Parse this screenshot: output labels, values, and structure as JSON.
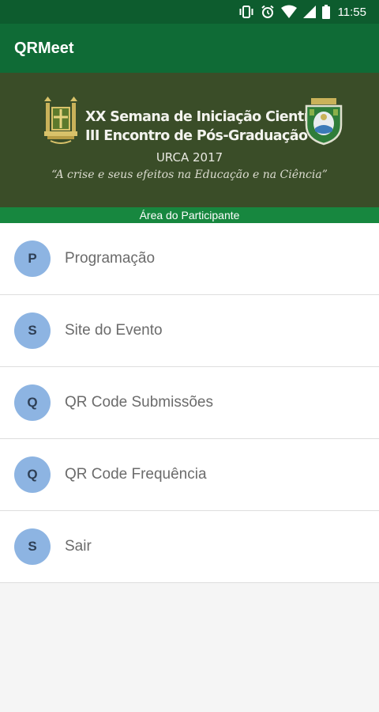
{
  "status_bar": {
    "time": "11:55",
    "icons": [
      "vibrate-icon",
      "alarm-icon",
      "wifi-icon",
      "signal-icon",
      "battery-icon"
    ]
  },
  "app_bar": {
    "title": "QRMeet"
  },
  "banner": {
    "title_line1": "XX Semana de Iniciação Científica",
    "title_line2": "III Encontro de Pós-Graduação",
    "edition": "URCA 2017",
    "motto": "“A crise e seus efeitos na Educação e na Ciência”",
    "left_logo": "university-crest-icon",
    "right_logo": "state-coat-of-arms-icon"
  },
  "section_strip": {
    "label": "Área do Participante"
  },
  "menu": {
    "items": [
      {
        "initial": "P",
        "label": "Programação"
      },
      {
        "initial": "S",
        "label": "Site do Evento"
      },
      {
        "initial": "Q",
        "label": "QR Code Submissões"
      },
      {
        "initial": "Q",
        "label": "QR Code Frequência"
      },
      {
        "initial": "S",
        "label": "Sair"
      }
    ]
  },
  "colors": {
    "status_bar": "#0d5c2e",
    "app_bar": "#0f6b36",
    "banner_bg": "#3a4d28",
    "section_strip": "#17873f",
    "avatar_bg": "#8db4e2",
    "avatar_text": "#2e3f55",
    "item_text": "#6b6b6b"
  }
}
